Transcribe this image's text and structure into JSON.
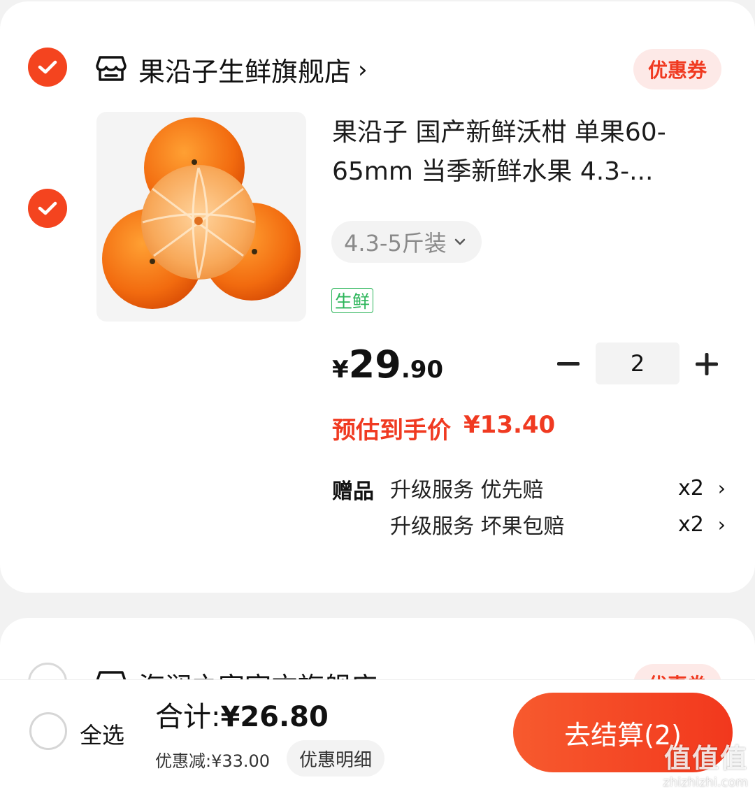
{
  "colors": {
    "accent": "#f03a21",
    "check": "#f4441f",
    "fresh_tag": "#2cb55a"
  },
  "store1": {
    "name": "果沿子生鲜旗舰店",
    "coupon": "优惠券",
    "selected": true
  },
  "product": {
    "title_line1": "果沿子 国产新鲜沃柑 单果60-",
    "title_line2": "65mm 当季新鲜水果 4.3-...",
    "spec": "4.3-5斤装",
    "tag": "生鲜",
    "price_symbol": "¥",
    "price_int": "29",
    "price_dec": ".90",
    "quantity": "2",
    "estimate_label": "预估到手价",
    "estimate_value": "¥13.40",
    "gift_label": "赠品",
    "gifts": [
      {
        "name": "升级服务 优先赔",
        "count": "x2"
      },
      {
        "name": "升级服务 坏果包赔",
        "count": "x2"
      }
    ]
  },
  "store2": {
    "name": "海澜之家官方旗舰店",
    "coupon": "优惠券"
  },
  "bottom_bar": {
    "select_all": "全选",
    "total_label": "合计:",
    "total_value": "¥26.80",
    "discount": "优惠减:¥33.00",
    "detail_button": "优惠明细",
    "checkout_button": "去结算(2)"
  },
  "watermark": {
    "logo": "值值值",
    "site": "zhizhizhi.com"
  }
}
